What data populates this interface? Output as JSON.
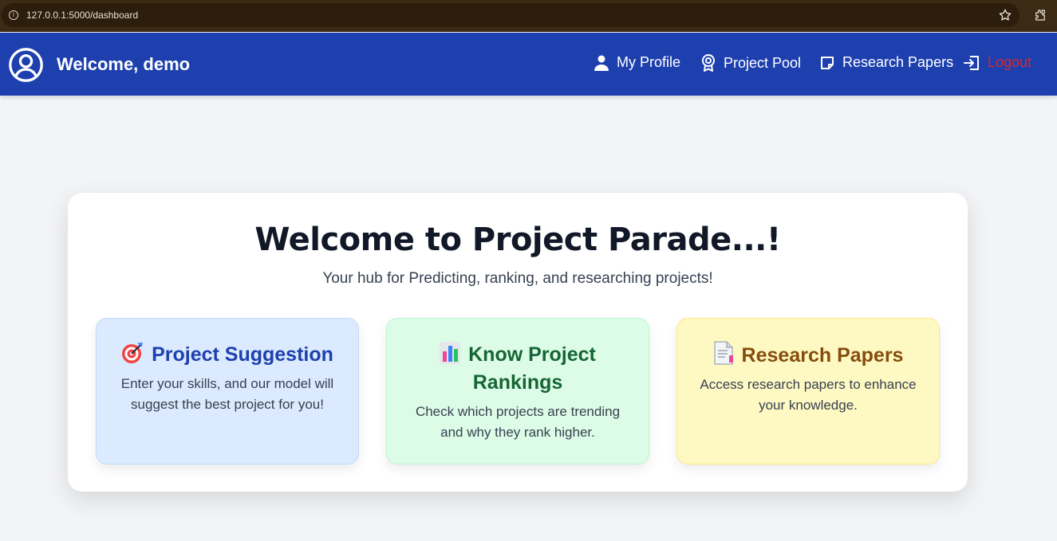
{
  "browser": {
    "url": "127.0.0.1:5000/dashboard",
    "info_icon": "i"
  },
  "navbar": {
    "welcome": "Welcome, demo",
    "links": [
      {
        "label": "My Profile",
        "icon": "person-icon"
      },
      {
        "label": "Project Pool",
        "icon": "badge-icon"
      },
      {
        "label": "Research Papers",
        "icon": "note-icon"
      },
      {
        "label": "Logout",
        "icon": "logout-icon",
        "color": "#dc2626"
      }
    ],
    "background": "#1e40af"
  },
  "hero": {
    "title": "Welcome to Project Parade...!",
    "subtitle": "Your hub for Predicting, ranking, and researching projects!"
  },
  "cards": [
    {
      "title": "Project Suggestion",
      "description": "Enter your skills, and our model will suggest the best project for you!",
      "icon": "target-icon",
      "background": "#dbeafe",
      "title_color": "#1e40af"
    },
    {
      "title": "Know Project Rankings",
      "description": "Check which projects are trending and why they rank higher.",
      "icon": "bar-chart-icon",
      "background": "#dcfce7",
      "title_color": "#166534"
    },
    {
      "title": "Research Papers",
      "description": "Access research papers to enhance your knowledge.",
      "icon": "document-icon",
      "background": "#fef9c3",
      "title_color": "#854d0e"
    }
  ]
}
